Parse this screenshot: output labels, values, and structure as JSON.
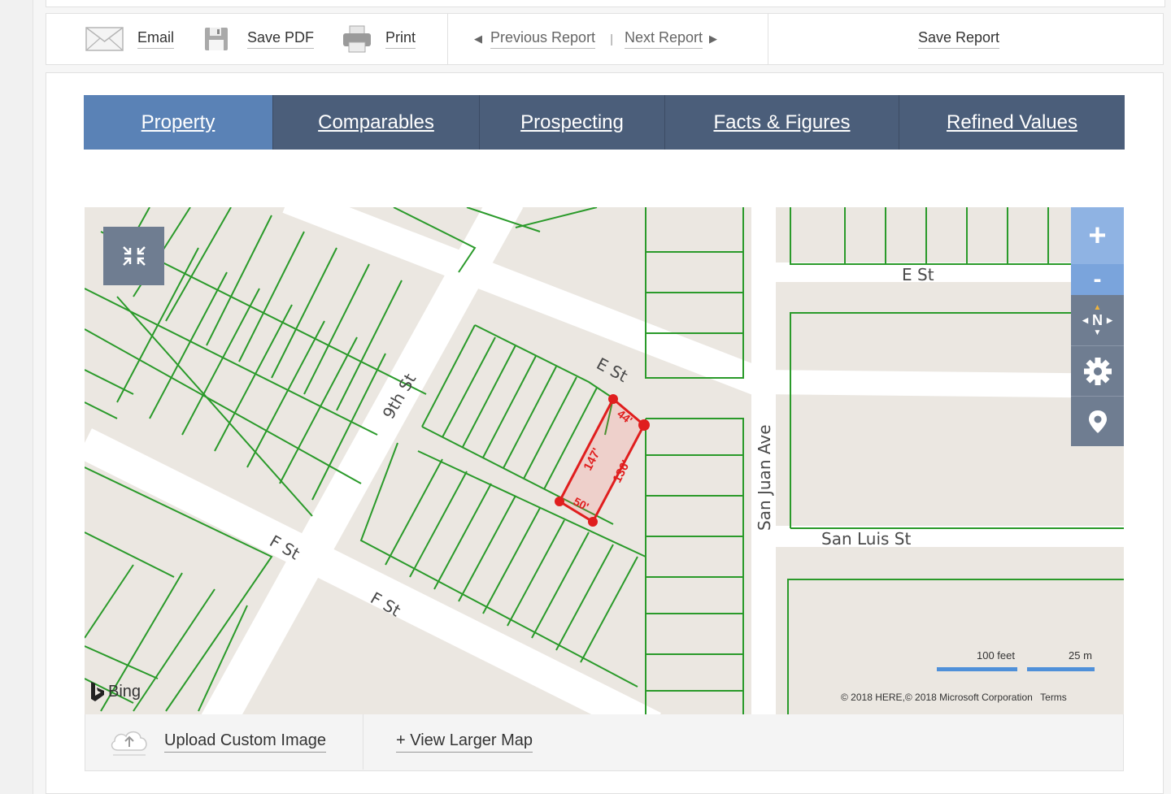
{
  "toolbar": {
    "email_label": "Email",
    "save_pdf_label": "Save PDF",
    "print_label": "Print",
    "prev_report_label": "Previous Report",
    "divider": "|",
    "next_report_label": "Next Report",
    "save_report_label": "Save Report"
  },
  "tabs": [
    {
      "label": "Property",
      "active": true
    },
    {
      "label": "Comparables",
      "active": false
    },
    {
      "label": "Prospecting",
      "active": false
    },
    {
      "label": "Facts & Figures",
      "active": false
    },
    {
      "label": "Refined Values",
      "active": false
    }
  ],
  "map": {
    "streets": {
      "e_st_top": "E St",
      "e_st_mid": "E St",
      "ninth_st": "9th St",
      "f_st_left": "F St",
      "f_st_right": "F St",
      "san_juan": "San Juan Ave",
      "san_luis": "San Luis St"
    },
    "parcel": {
      "dim_front": "44'",
      "dim_left": "147'",
      "dim_right": "136'",
      "dim_back": "50'"
    },
    "controls": {
      "zoom_in": "+",
      "zoom_out": "-",
      "compass": "N"
    },
    "scale": {
      "feet_label": "100 feet",
      "meters_label": "25 m"
    },
    "copyright": "© 2018 HERE,© 2018 Microsoft Corporation",
    "terms": "Terms",
    "bing_label": "Bing",
    "colors": {
      "parcel_lines": "#2a9a2a",
      "selected_parcel": "#e01e1e",
      "road": "#ffffff",
      "land": "#ebe7e1"
    }
  },
  "map_footer": {
    "upload_label": "Upload Custom Image",
    "view_larger_label": "+ View Larger Map"
  }
}
